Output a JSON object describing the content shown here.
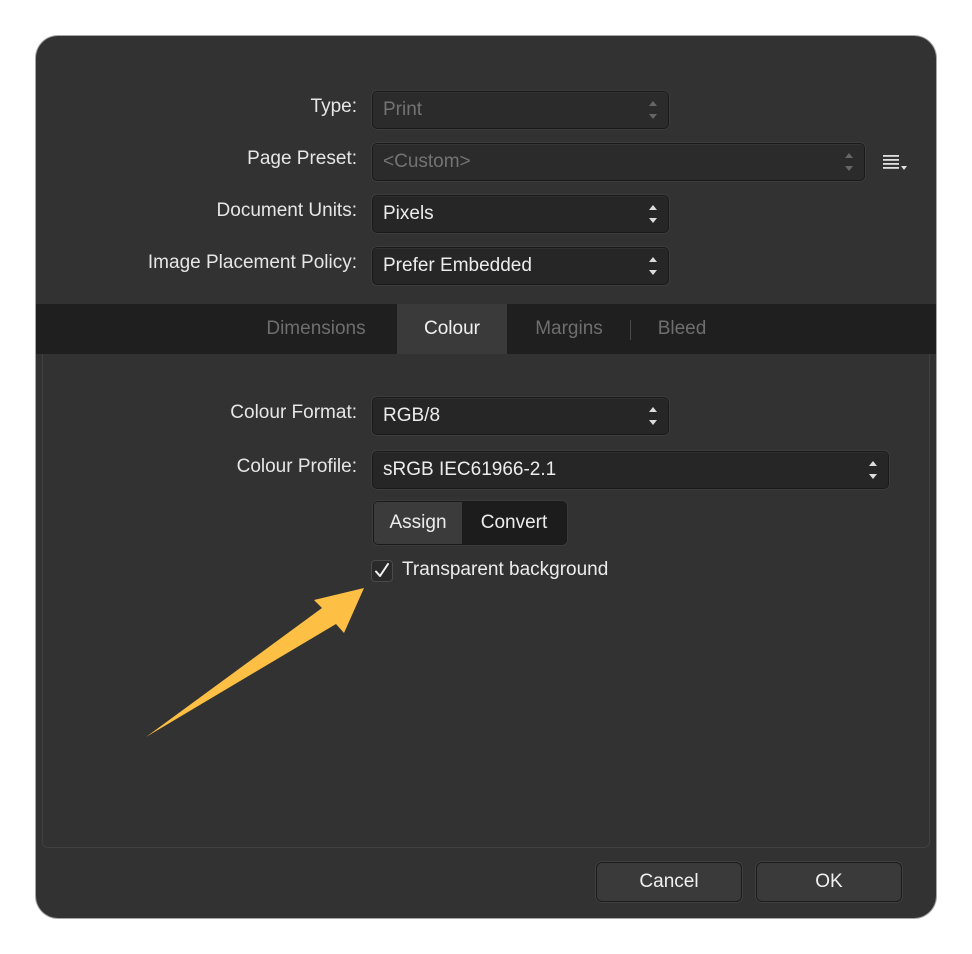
{
  "doc": {
    "type": {
      "label": "Type:",
      "value": "Print"
    },
    "page_preset": {
      "label": "Page Preset:",
      "value": "<Custom>"
    },
    "document_units": {
      "label": "Document Units:",
      "value": "Pixels"
    },
    "image_placement": {
      "label": "Image Placement Policy:",
      "value": "Prefer Embedded"
    }
  },
  "tabs": [
    {
      "label": "Dimensions"
    },
    {
      "label": "Colour"
    },
    {
      "label": "Margins"
    },
    {
      "label": "Bleed"
    }
  ],
  "colour": {
    "format": {
      "label": "Colour Format:",
      "value": "RGB/8"
    },
    "profile": {
      "label": "Colour Profile:",
      "value": "sRGB IEC61966-2.1"
    },
    "assign_label": "Assign",
    "convert_label": "Convert",
    "transparent_label": "Transparent background",
    "transparent_checked": true
  },
  "buttons": {
    "cancel": "Cancel",
    "ok": "OK"
  },
  "colors": {
    "dialog_bg": "#323232",
    "arrow": "#fdc044",
    "tabbar_bg": "#1f1f1f"
  }
}
